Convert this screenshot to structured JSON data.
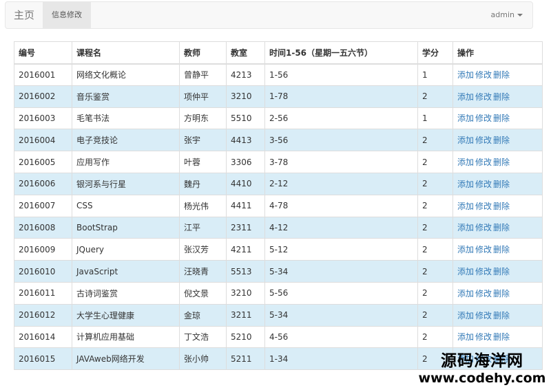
{
  "navbar": {
    "brand": "主页",
    "active_tab": "信息修改",
    "user": "admin"
  },
  "table": {
    "headers": [
      "编号",
      "课程名",
      "教师",
      "教室",
      "时间1-56（星期一五六节）",
      "学分",
      "操作"
    ],
    "actions": [
      "添加",
      "修改",
      "删除"
    ],
    "rows": [
      {
        "id": "2016001",
        "course": "网络文化概论",
        "teacher": "曾静平",
        "room": "4213",
        "time": "1-56",
        "credit": "1",
        "highlight": false
      },
      {
        "id": "2016002",
        "course": "音乐鉴赏",
        "teacher": "项仲平",
        "room": "3210",
        "time": "1-78",
        "credit": "2",
        "highlight": true
      },
      {
        "id": "2016003",
        "course": "毛笔书法",
        "teacher": "方明东",
        "room": "5510",
        "time": "2-56",
        "credit": "1",
        "highlight": false
      },
      {
        "id": "2016004",
        "course": "电子竞技论",
        "teacher": "张宇",
        "room": "4413",
        "time": "3-56",
        "credit": "2",
        "highlight": true
      },
      {
        "id": "2016005",
        "course": "应用写作",
        "teacher": "叶蓉",
        "room": "3306",
        "time": "3-78",
        "credit": "2",
        "highlight": false
      },
      {
        "id": "2016006",
        "course": "银河系与行星",
        "teacher": "魏丹",
        "room": "4410",
        "time": "2-12",
        "credit": "2",
        "highlight": true
      },
      {
        "id": "2016007",
        "course": "CSS",
        "teacher": "杨光伟",
        "room": "4411",
        "time": "4-78",
        "credit": "2",
        "highlight": false
      },
      {
        "id": "2016008",
        "course": "BootStrap",
        "teacher": "江平",
        "room": "2311",
        "time": "4-12",
        "credit": "2",
        "highlight": true
      },
      {
        "id": "2016009",
        "course": "JQuery",
        "teacher": "张汉芳",
        "room": "4211",
        "time": "5-12",
        "credit": "2",
        "highlight": false
      },
      {
        "id": "2016010",
        "course": "JavaScript",
        "teacher": "汪晓青",
        "room": "5513",
        "time": "5-34",
        "credit": "2",
        "highlight": true
      },
      {
        "id": "2016011",
        "course": "古诗词鉴赏",
        "teacher": "倪文景",
        "room": "3210",
        "time": "5-56",
        "credit": "2",
        "highlight": false
      },
      {
        "id": "2016012",
        "course": "大学生心理健康",
        "teacher": "金琼",
        "room": "3211",
        "time": "5-34",
        "credit": "2",
        "highlight": true
      },
      {
        "id": "2016014",
        "course": "计算机应用基础",
        "teacher": "丁文浩",
        "room": "5210",
        "time": "4-56",
        "credit": "2",
        "highlight": false
      },
      {
        "id": "2016015",
        "course": "JAVAweb网络开发",
        "teacher": "张小帅",
        "room": "5211",
        "time": "1-34",
        "credit": "2",
        "highlight": true
      }
    ]
  },
  "watermark": {
    "line1": "源码海洋网",
    "line2": "www.codehy.com"
  },
  "colors": {
    "row_highlight": "#d9edf7",
    "link": "#337ab7",
    "navbar_bg": "#f8f8f8",
    "active_tab_bg": "#e7e7e7"
  }
}
